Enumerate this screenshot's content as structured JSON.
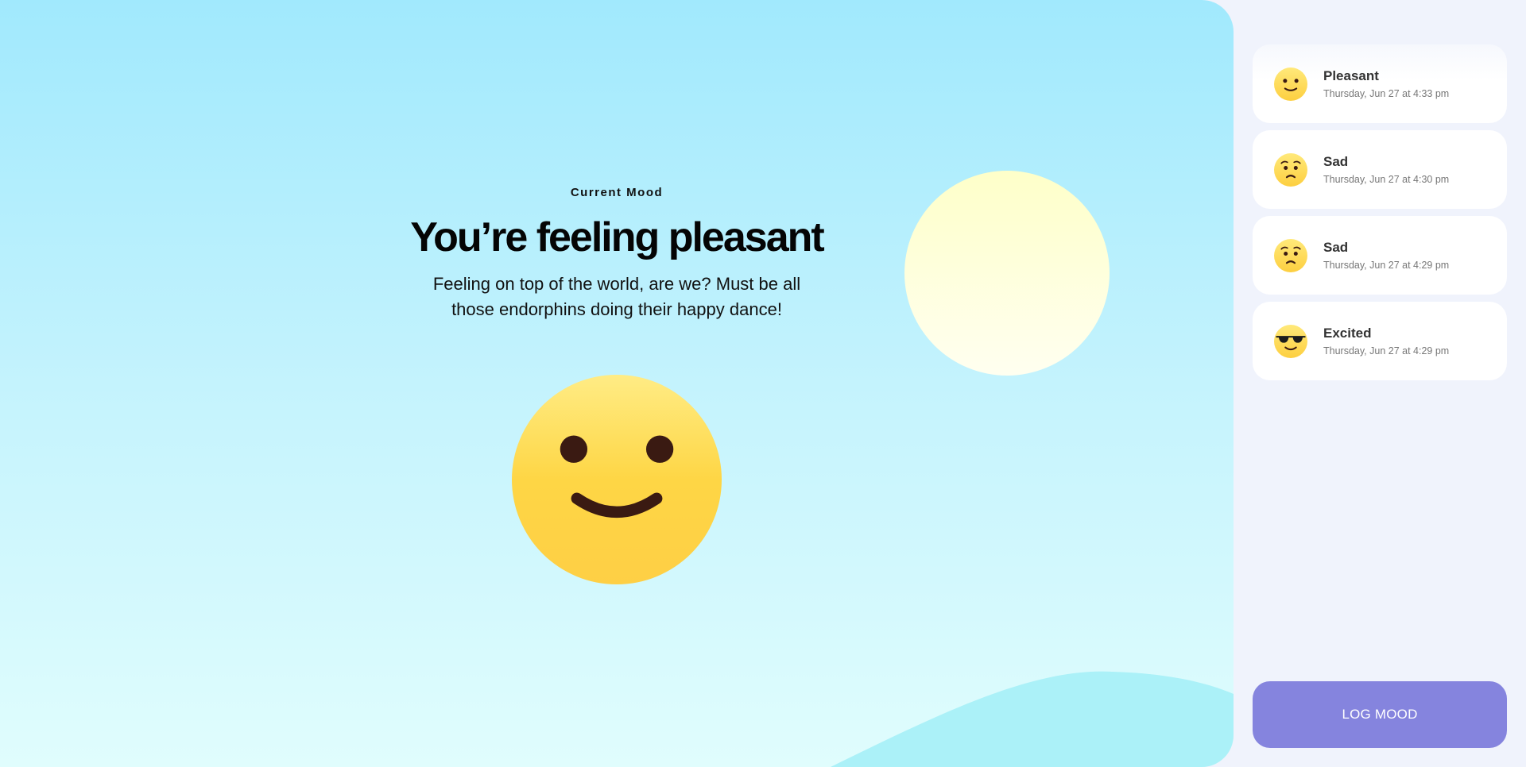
{
  "current_mood": {
    "eyebrow": "Current Mood",
    "title": "You’re feeling pleasant",
    "description": "Feeling on top of the world, are we? Must be all those endorphins doing their happy dance!",
    "emoji": "slightly-smiling-face-icon"
  },
  "colors": {
    "sky_top": "#a1e9fd",
    "sky_bottom": "#e0fdfd",
    "sun": "#feffc9",
    "hill": "#abf1f8",
    "sidebar_bg": "#f0f3fc",
    "button": "#8584de",
    "emoji_yellow": "#fed43f",
    "emoji_features": "#3a1a12"
  },
  "history": {
    "entries": [
      {
        "mood": "Pleasant",
        "time": "Thursday, Jun 27 at 4:33 pm",
        "icon": "slightly-smiling-face-icon"
      },
      {
        "mood": "Sad",
        "time": "Thursday, Jun 27 at 4:30 pm",
        "icon": "worried-face-icon"
      },
      {
        "mood": "Sad",
        "time": "Thursday, Jun 27 at 4:29 pm",
        "icon": "worried-face-icon"
      },
      {
        "mood": "Excited",
        "time": "Thursday, Jun 27 at 4:29 pm",
        "icon": "sunglasses-face-icon"
      }
    ]
  },
  "actions": {
    "log_mood_label": "LOG MOOD"
  }
}
